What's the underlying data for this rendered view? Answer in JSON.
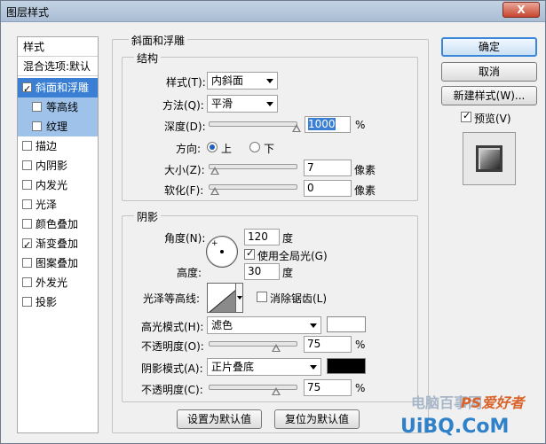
{
  "window": {
    "title": "图层样式",
    "close": "X"
  },
  "sidebar": {
    "header": "样式",
    "blend": "混合选项:默认",
    "items": [
      {
        "label": "斜面和浮雕",
        "checked": true
      },
      {
        "label": "等高线",
        "checked": false
      },
      {
        "label": "纹理",
        "checked": false
      },
      {
        "label": "描边",
        "checked": false
      },
      {
        "label": "内阴影",
        "checked": false
      },
      {
        "label": "内发光",
        "checked": false
      },
      {
        "label": "光泽",
        "checked": false
      },
      {
        "label": "颜色叠加",
        "checked": false
      },
      {
        "label": "渐变叠加",
        "checked": true
      },
      {
        "label": "图案叠加",
        "checked": false
      },
      {
        "label": "外发光",
        "checked": false
      },
      {
        "label": "投影",
        "checked": false
      }
    ]
  },
  "bevel": {
    "group_title": "斜面和浮雕",
    "structure_title": "结构",
    "style_label": "样式(T):",
    "style_value": "内斜面",
    "technique_label": "方法(Q):",
    "technique_value": "平滑",
    "depth_label": "深度(D):",
    "depth_value": "1000",
    "depth_unit": "%",
    "direction_label": "方向:",
    "dir_up": "上",
    "dir_down": "下",
    "size_label": "大小(Z):",
    "size_value": "7",
    "size_unit": "像素",
    "soften_label": "软化(F):",
    "soften_value": "0",
    "soften_unit": "像素"
  },
  "shading": {
    "title": "阴影",
    "angle_label": "角度(N):",
    "angle_value": "120",
    "angle_unit": "度",
    "global_light": "使用全局光(G)",
    "altitude_label": "高度:",
    "altitude_value": "30",
    "altitude_unit": "度",
    "gloss_label": "光泽等高线:",
    "antialias": "消除锯齿(L)",
    "highlight_label": "高光模式(H):",
    "highlight_mode": "滤色",
    "highlight_color": "#ffffff",
    "hl_opacity_label": "不透明度(O):",
    "hl_opacity_value": "75",
    "shadow_label": "阴影模式(A):",
    "shadow_mode": "正片叠底",
    "shadow_color": "#000000",
    "sh_opacity_label": "不透明度(C):",
    "sh_opacity_value": "75",
    "percent": "%"
  },
  "footer": {
    "set_default": "设置为默认值",
    "reset_default": "复位为默认值"
  },
  "right": {
    "ok": "确定",
    "cancel": "取消",
    "new_style": "新建样式(W)...",
    "preview": "预览(V)"
  },
  "watermark": {
    "line1": "电脑百事网",
    "line2": "PS爱好者",
    "line3": "UiBQ.CoM"
  }
}
